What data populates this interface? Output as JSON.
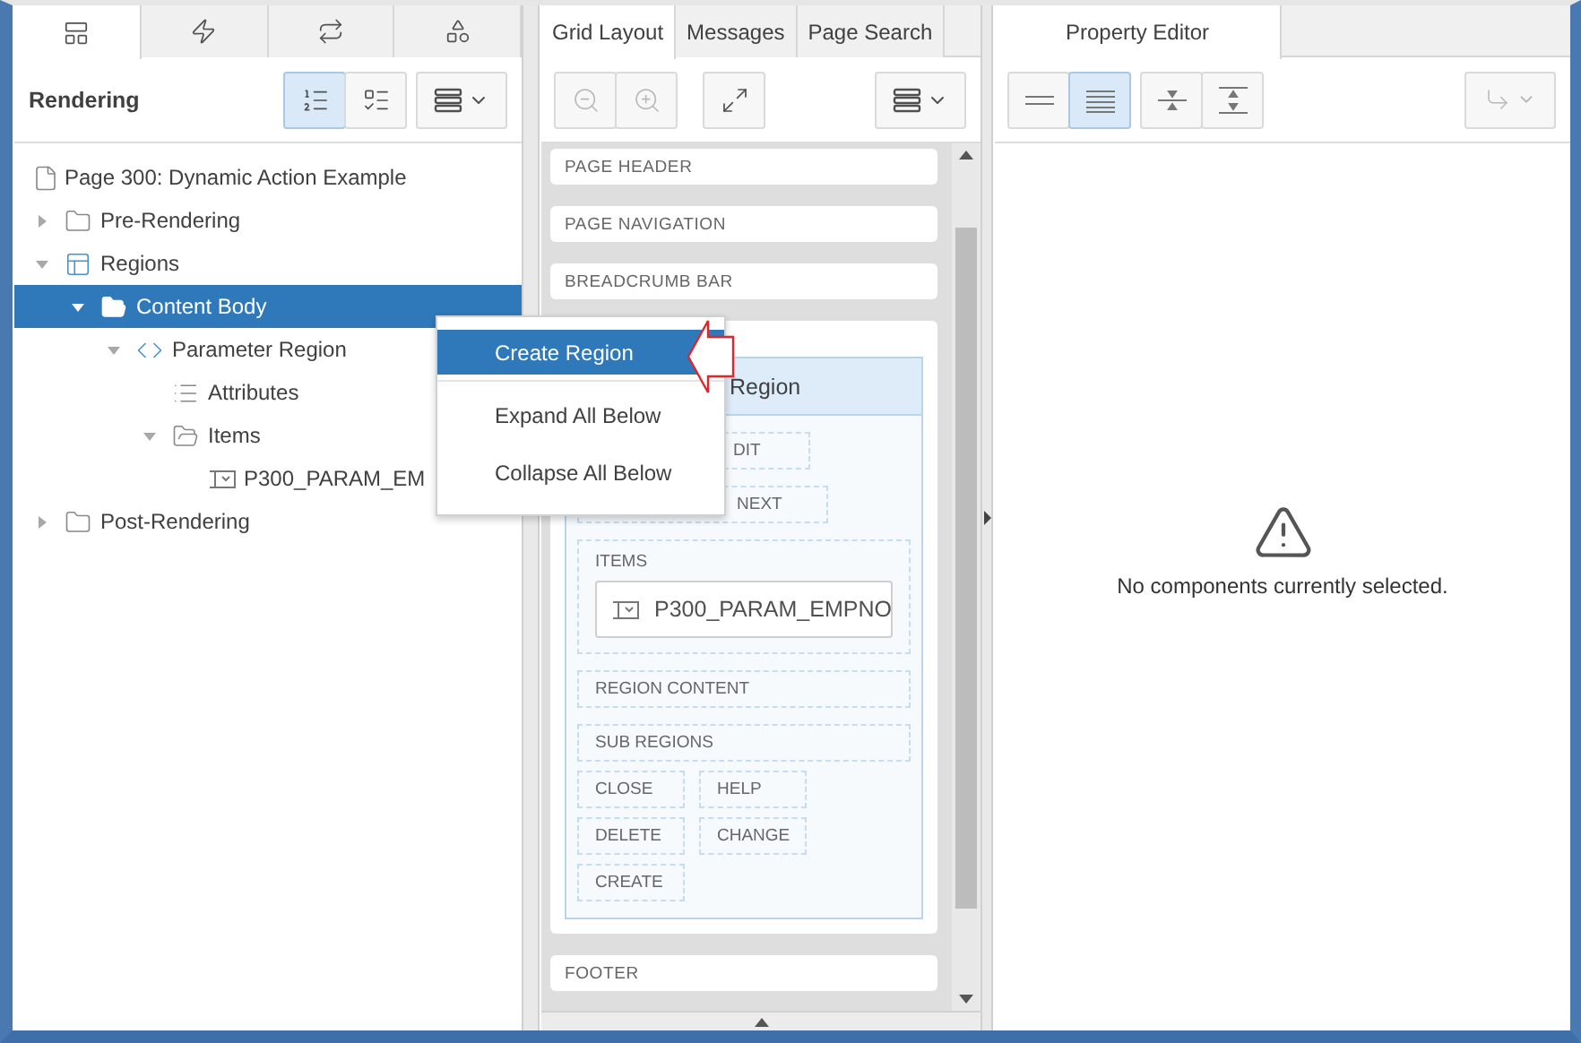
{
  "left_panel": {
    "tabs": [
      {
        "kind": "rendering",
        "selected": true
      },
      {
        "kind": "dynamic_actions",
        "selected": false
      },
      {
        "kind": "processing",
        "selected": false
      },
      {
        "kind": "shared_components",
        "selected": false
      }
    ],
    "title": "Rendering",
    "view_buttons": [
      {
        "kind": "tree",
        "selected": true
      },
      {
        "kind": "component",
        "selected": false
      }
    ],
    "tree": [
      {
        "label": "Page 300: Dynamic Action Example",
        "kind": "page",
        "selected": false,
        "children": [
          {
            "label": "Pre-Rendering",
            "kind": "folder",
            "expanded": false,
            "selected": false
          },
          {
            "label": "Regions",
            "kind": "regions",
            "expanded": true,
            "selected": false,
            "children": [
              {
                "label": "Content Body",
                "kind": "folder_open",
                "expanded": true,
                "selected": true,
                "children": [
                  {
                    "label": "Parameter Region",
                    "kind": "region",
                    "expanded": true,
                    "selected": false,
                    "children": [
                      {
                        "label": "Attributes",
                        "kind": "attributes",
                        "selected": false
                      },
                      {
                        "label": "Items",
                        "kind": "folder_open",
                        "expanded": true,
                        "selected": false,
                        "children": [
                          {
                            "label": "P300_PARAM_EM",
                            "kind": "item",
                            "selected": false
                          }
                        ]
                      }
                    ]
                  }
                ]
              }
            ]
          },
          {
            "label": "Post-Rendering",
            "kind": "folder",
            "expanded": false,
            "selected": false
          }
        ]
      }
    ]
  },
  "middle_panel": {
    "tabs": [
      {
        "label": "Grid Layout",
        "selected": true
      },
      {
        "label": "Messages",
        "selected": false
      },
      {
        "label": "Page Search",
        "selected": false
      }
    ],
    "zoom_buttons": [
      {
        "kind": "zoom_out",
        "disabled": true
      },
      {
        "kind": "zoom_in",
        "disabled": true
      }
    ],
    "sections_top": [
      "PAGE HEADER",
      "PAGE NAVIGATION",
      "BREADCRUMB BAR"
    ],
    "region": {
      "title": "Region",
      "slot_rows": [
        {
          "label": "DIT"
        },
        {
          "label": "NEXT"
        }
      ],
      "items_slot": {
        "label": "ITEMS",
        "item": "P300_PARAM_EMPNO"
      },
      "wide_slots": [
        "REGION CONTENT",
        "SUB REGIONS"
      ],
      "button_slots": [
        [
          "CLOSE",
          "HELP"
        ],
        [
          "DELETE",
          "CHANGE"
        ],
        [
          "CREATE"
        ]
      ]
    },
    "sections_bottom": [
      "FOOTER"
    ]
  },
  "right_panel": {
    "tab": {
      "label": "Property Editor",
      "selected": true
    },
    "layout_buttons": [
      {
        "kind": "one_column",
        "selected": false
      },
      {
        "kind": "two_column",
        "selected": true
      }
    ],
    "expand_buttons": [
      {
        "kind": "collapse_all"
      },
      {
        "kind": "expand_all"
      }
    ],
    "go_to_button": {
      "disabled": true
    },
    "message": "No components currently selected."
  },
  "context_menu": {
    "items": [
      {
        "label": "Create Region",
        "selected": true
      },
      {
        "label": "Expand All Below",
        "selected": false
      },
      {
        "label": "Collapse All Below",
        "selected": false
      }
    ]
  }
}
